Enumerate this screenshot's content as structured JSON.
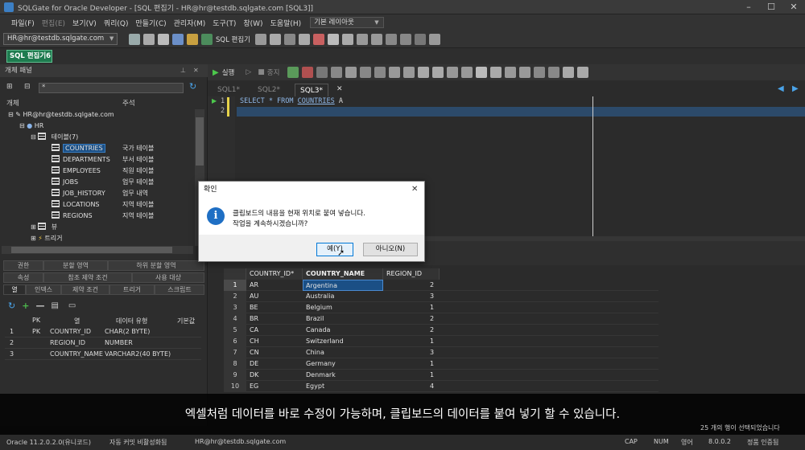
{
  "window": {
    "title": "SQLGate for Oracle Developer - [SQL 편집기 - HR@hr@testdb.sqlgate.com [SQL3]]"
  },
  "menu": {
    "items": [
      "파일(F)",
      "편집(E)",
      "보기(V)",
      "쿼리(Q)",
      "만들기(C)",
      "관리자(M)",
      "도구(T)",
      "창(W)",
      "도움말(H)"
    ],
    "layout_select": "기본 레이아웃"
  },
  "toolbar": {
    "connection": "HR@hr@testdb.sqlgate.com",
    "sql_editor_label": "SQL 편집기"
  },
  "doc_tab": {
    "label": "SQL 편집기6"
  },
  "object_panel": {
    "title": "개체 패널",
    "filter_value": "*",
    "col_object": "개체",
    "col_comment": "주석",
    "tree": {
      "root": "HR@hr@testdb.sqlgate.com",
      "schema": "HR",
      "tables_folder": "테이블(7)",
      "tables": [
        {
          "name": "COUNTRIES",
          "comment": "국가 테이블"
        },
        {
          "name": "DEPARTMENTS",
          "comment": "부서 테이블"
        },
        {
          "name": "EMPLOYEES",
          "comment": "직원 테이블"
        },
        {
          "name": "JOBS",
          "comment": "업무 테이블"
        },
        {
          "name": "JOB_HISTORY",
          "comment": "업무 내역"
        },
        {
          "name": "LOCATIONS",
          "comment": "지역 테이블"
        },
        {
          "name": "REGIONS",
          "comment": "지역 테이블"
        }
      ],
      "views_folder": "뷰",
      "triggers_folder": "트리거"
    },
    "prop_tabs_row1": [
      "권한",
      "분할 영역",
      "하위 분할 영역"
    ],
    "prop_tabs_row2": [
      "속성",
      "참조 제약 조건",
      "사용 대상"
    ],
    "prop_tabs_row3": [
      "열",
      "인덱스",
      "제약 조건",
      "트리거",
      "스크립트"
    ],
    "prop_headers": [
      "PK",
      "열",
      "데이터 유형",
      "기본값"
    ],
    "prop_rows": [
      {
        "num": "1",
        "pk": "PK",
        "col": "COUNTRY_ID",
        "type": "CHAR(2 BYTE)"
      },
      {
        "num": "2",
        "pk": "",
        "col": "REGION_ID",
        "type": "NUMBER"
      },
      {
        "num": "3",
        "pk": "",
        "col": "COUNTRY_NAME",
        "type": "VARCHAR2(40 BYTE)"
      }
    ]
  },
  "editor": {
    "run_label": "실행",
    "stop_label": "중지",
    "tabs": [
      "SQL1*",
      "SQL2*",
      "SQL3*"
    ],
    "line1_num": "1",
    "line2_num": "2",
    "code_line1_kw": "SELECT * FROM ",
    "code_line1_table": "COUNTRIES",
    "code_line1_alias": " A"
  },
  "result_grid": {
    "headers": [
      "COUNTRY_ID*",
      "COUNTRY_NAME",
      "REGION_ID"
    ],
    "rows": [
      {
        "n": "1",
        "id": "AR",
        "name": "Argentina",
        "region": "2"
      },
      {
        "n": "2",
        "id": "AU",
        "name": "Australia",
        "region": "3"
      },
      {
        "n": "3",
        "id": "BE",
        "name": "Belgium",
        "region": "1"
      },
      {
        "n": "4",
        "id": "BR",
        "name": "Brazil",
        "region": "2"
      },
      {
        "n": "5",
        "id": "CA",
        "name": "Canada",
        "region": "2"
      },
      {
        "n": "6",
        "id": "CH",
        "name": "Switzerland",
        "region": "1"
      },
      {
        "n": "7",
        "id": "CN",
        "name": "China",
        "region": "3"
      },
      {
        "n": "8",
        "id": "DE",
        "name": "Germany",
        "region": "1"
      },
      {
        "n": "9",
        "id": "DK",
        "name": "Denmark",
        "region": "1"
      },
      {
        "n": "10",
        "id": "EG",
        "name": "Egypt",
        "region": "4"
      }
    ]
  },
  "dialog": {
    "title": "확인",
    "message_line1": "클립보드의 내용을 현재 위치로 붙여 넣습니다.",
    "message_line2": "작업을 계속하시겠습니까?",
    "yes_label": "예(Y)",
    "no_label": "아니오(N)"
  },
  "subtitle": "엑셀처럼 데이터를 바로 수정이 가능하며, 클립보드의 데이터를 붙여 넣기 할 수 있습니다.",
  "statusbar": {
    "oracle_version": "Oracle 11.2.0.2.0(유니코드)",
    "autocommit": "자동 커밋 비활성화됨",
    "connection": "HR@hr@testdb.sqlgate.com",
    "selected_rows": "25 개의 행이 선택되었습니다",
    "caps": "CAP",
    "num": "NUM",
    "lang": "영어",
    "version": "8.0.0.2",
    "license": "정품 인증됨"
  },
  "colors": {
    "accent_green": "#1e7b4f",
    "selection_blue": "#1b4f85",
    "info_blue": "#1f6fc4"
  }
}
